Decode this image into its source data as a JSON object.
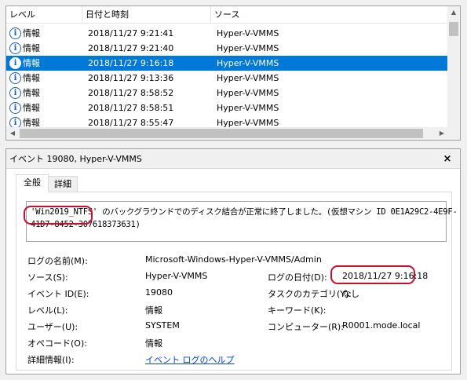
{
  "event_list": {
    "columns": [
      "レベル",
      "日付と時刻",
      "ソース"
    ],
    "rows": [
      {
        "level": "情報",
        "datetime": "2018/11/27 9:21:41",
        "source": "Hyper-V-VMMS"
      },
      {
        "level": "情報",
        "datetime": "2018/11/27 9:21:40",
        "source": "Hyper-V-VMMS"
      },
      {
        "level": "情報",
        "datetime": "2018/11/27 9:16:18",
        "source": "Hyper-V-VMMS"
      },
      {
        "level": "情報",
        "datetime": "2018/11/27 9:13:36",
        "source": "Hyper-V-VMMS"
      },
      {
        "level": "情報",
        "datetime": "2018/11/27 8:58:52",
        "source": "Hyper-V-VMMS"
      },
      {
        "level": "情報",
        "datetime": "2018/11/27 8:58:51",
        "source": "Hyper-V-VMMS"
      },
      {
        "level": "情報",
        "datetime": "2018/11/27 8:55:47",
        "source": "Hyper-V-VMMS"
      }
    ],
    "selected_index": 2
  },
  "icons": {
    "info": "i",
    "close": "×",
    "scroll_up": "▲",
    "scroll_down": "▼",
    "scroll_left": "◀",
    "scroll_right": "▶"
  },
  "detail": {
    "title": "イベント 19080, Hyper-V-VMMS",
    "tabs": [
      "全般",
      "詳細"
    ],
    "description": {
      "line1": "'Win2019_NTFS' のバックグラウンドでのディスク結合が正常に終了しました。(仮想マシン ID 0E1A29C2-4E9F-",
      "line2": "41D7-8452-307618373631)"
    },
    "fields": {
      "log_name_label": "ログの名前(M):",
      "log_name_value": "Microsoft-Windows-Hyper-V-VMMS/Admin",
      "source_label": "ソース(S):",
      "source_value": "Hyper-V-VMMS",
      "logged_label": "ログの日付(D):",
      "logged_value": "2018/11/27 9:16:18",
      "event_id_label": "イベント ID(E):",
      "event_id_value": "19080",
      "task_label": "タスクのカテゴリ(Y):",
      "task_value": "なし",
      "level_label": "レベル(L):",
      "level_value": "情報",
      "keywords_label": "キーワード(K):",
      "keywords_value": "",
      "user_label": "ユーザー(U):",
      "user_value": "SYSTEM",
      "computer_label": "コンピューター(R):",
      "computer_value": "R0001.mode.local",
      "opcode_label": "オペコード(O):",
      "opcode_value": "情報",
      "more_info_label": "詳細情報(I):",
      "more_info_link": "イベント ログのヘルプ"
    }
  },
  "colors": {
    "selection": "#0078d7",
    "highlight_ring": "#c8102e",
    "link": "#0046d5"
  }
}
